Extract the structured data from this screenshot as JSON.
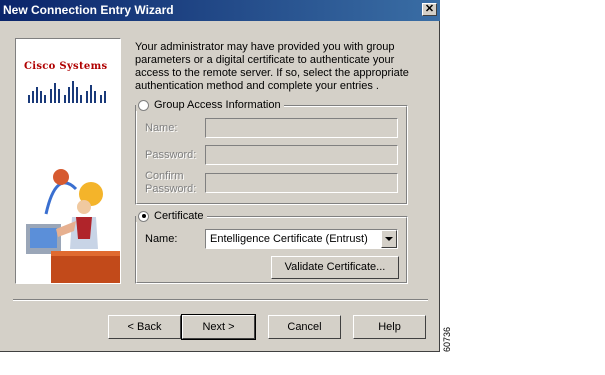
{
  "window": {
    "title": "New Connection Entry Wizard",
    "close_label": "✕"
  },
  "banner": {
    "logo_text": "Cisco Systems"
  },
  "intro_text": "Your administrator may have provided you with group parameters or a digital certificate to authenticate your access to the remote server.  If so, select the appropriate authentication method and complete your entries .",
  "group_access": {
    "label": "Group Access Information",
    "selected": false,
    "name_label": "Name:",
    "password_label": "Password:",
    "confirm_label_1": "Confirm",
    "confirm_label_2": "Password:",
    "name_value": "",
    "password_value": "",
    "confirm_value": ""
  },
  "certificate": {
    "label": "Certificate",
    "selected": true,
    "name_label": "Name:",
    "selected_cert": "Entelligence Certificate (Entrust)",
    "validate_label": "Validate Certificate..."
  },
  "buttons": {
    "back": "< Back",
    "next": "Next >",
    "cancel": "Cancel",
    "help": "Help"
  },
  "figure_id": "60736"
}
